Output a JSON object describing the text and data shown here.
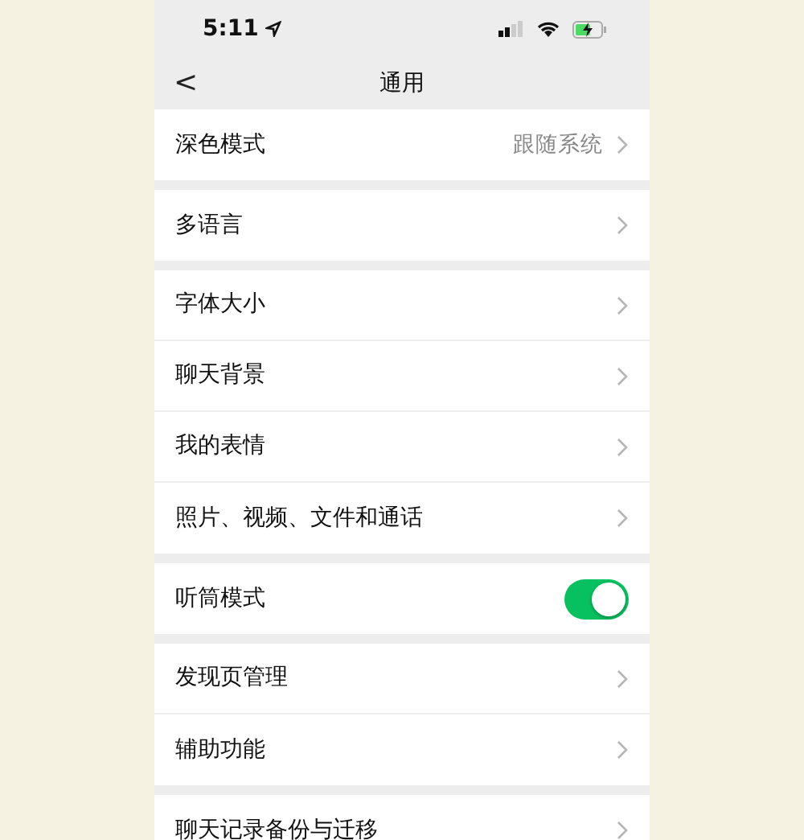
{
  "status_bar": {
    "time": "5:11"
  },
  "nav": {
    "back": "<",
    "title": "通用"
  },
  "groups": [
    [
      {
        "kind": "link",
        "label": "深色模式",
        "value": "跟随系统"
      }
    ],
    [
      {
        "kind": "link",
        "label": "多语言"
      }
    ],
    [
      {
        "kind": "link",
        "label": "字体大小"
      },
      {
        "kind": "link",
        "label": "聊天背景"
      },
      {
        "kind": "link",
        "label": "我的表情"
      },
      {
        "kind": "link",
        "label": "照片、视频、文件和通话"
      }
    ],
    [
      {
        "kind": "switch",
        "label": "听筒模式",
        "on": true
      }
    ],
    [
      {
        "kind": "link",
        "label": "发现页管理"
      },
      {
        "kind": "link",
        "label": "辅助功能"
      }
    ],
    [
      {
        "kind": "link",
        "label": "聊天记录备份与迁移"
      }
    ]
  ]
}
